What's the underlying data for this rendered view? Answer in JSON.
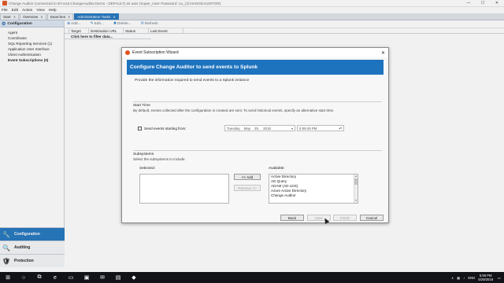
{
  "window": {
    "title": "Change Auditor (connected to sf-nv16.ChangeAuditor.Demo - DEFAULT) as user (Super_User Password: ca_) [CHANGEAUDITOR]",
    "minimize": "—",
    "maximize": "☐",
    "close": "✕"
  },
  "menu": [
    "File",
    "Edit",
    "Action",
    "View",
    "Help"
  ],
  "tabs": [
    {
      "label": "Start",
      "active": false
    },
    {
      "label": "Overview",
      "active": false
    },
    {
      "label": "Searches",
      "active": false
    },
    {
      "label": "Administration Tasks",
      "active": true
    }
  ],
  "sidebar": {
    "header": "Configuration",
    "items": [
      {
        "label": "Agent",
        "bold": false
      },
      {
        "label": "Coordinator",
        "bold": false
      },
      {
        "label": "SQL Reporting Services (1)",
        "bold": false
      },
      {
        "label": "Application User Interface",
        "bold": false
      },
      {
        "label": "Client Authentication",
        "bold": false
      },
      {
        "label": "Event Subscriptions (0)",
        "bold": true
      }
    ],
    "nav": [
      {
        "label": "Configuration",
        "icon": "wrench-icon",
        "active": true
      },
      {
        "label": "Auditing",
        "icon": "magnifier-icon",
        "active": false
      },
      {
        "label": "Protection",
        "icon": "shield-icon",
        "active": false
      }
    ]
  },
  "toolbar": {
    "add": "Add...",
    "edit": "Edit...",
    "delete": "Delete...",
    "refresh": "Refresh"
  },
  "grid": {
    "columns": [
      "Target",
      "Destination URL",
      "Status",
      "Last Event"
    ],
    "filter_placeholder": "Click here to filter data..."
  },
  "dialog": {
    "title": "Event Subscription Wizard",
    "banner": "Configure Change Auditor to send events to Splunk",
    "intro": "Provide the information required to send events to a Splunk instance",
    "start_time": {
      "title": "Start Time",
      "description": "By default, events collected after the configuration is created are sent. To send historical events, specify an alternative start time.",
      "checkbox_label": "Send events starting from:",
      "checked": false,
      "date": {
        "weekday": "Tuesday",
        "month": "May",
        "day": "29,",
        "year": "2018"
      },
      "time": "5:59:45 PM"
    },
    "subsystems": {
      "title": "Subsystems",
      "description": "Select the subsystems to include.",
      "selected_label": "Selected:",
      "available_label": "Available:",
      "selected": [],
      "available": [
        "Active Directory",
        "AD Query",
        "ADAM (AD LDS)",
        "Azure Active Directory",
        "Change Auditor"
      ],
      "add_button": "<< Add",
      "remove_button": "Remove >>"
    },
    "buttons": {
      "back": "Back",
      "next": "Next",
      "finish": "Finish",
      "cancel": "Cancel"
    }
  },
  "taskbar": {
    "language": "ENG",
    "time": "5:59 PM",
    "date": "5/29/2018"
  },
  "colors": {
    "accent": "#1e73be",
    "brand": "#e2531f",
    "taskbar": "#111317"
  }
}
